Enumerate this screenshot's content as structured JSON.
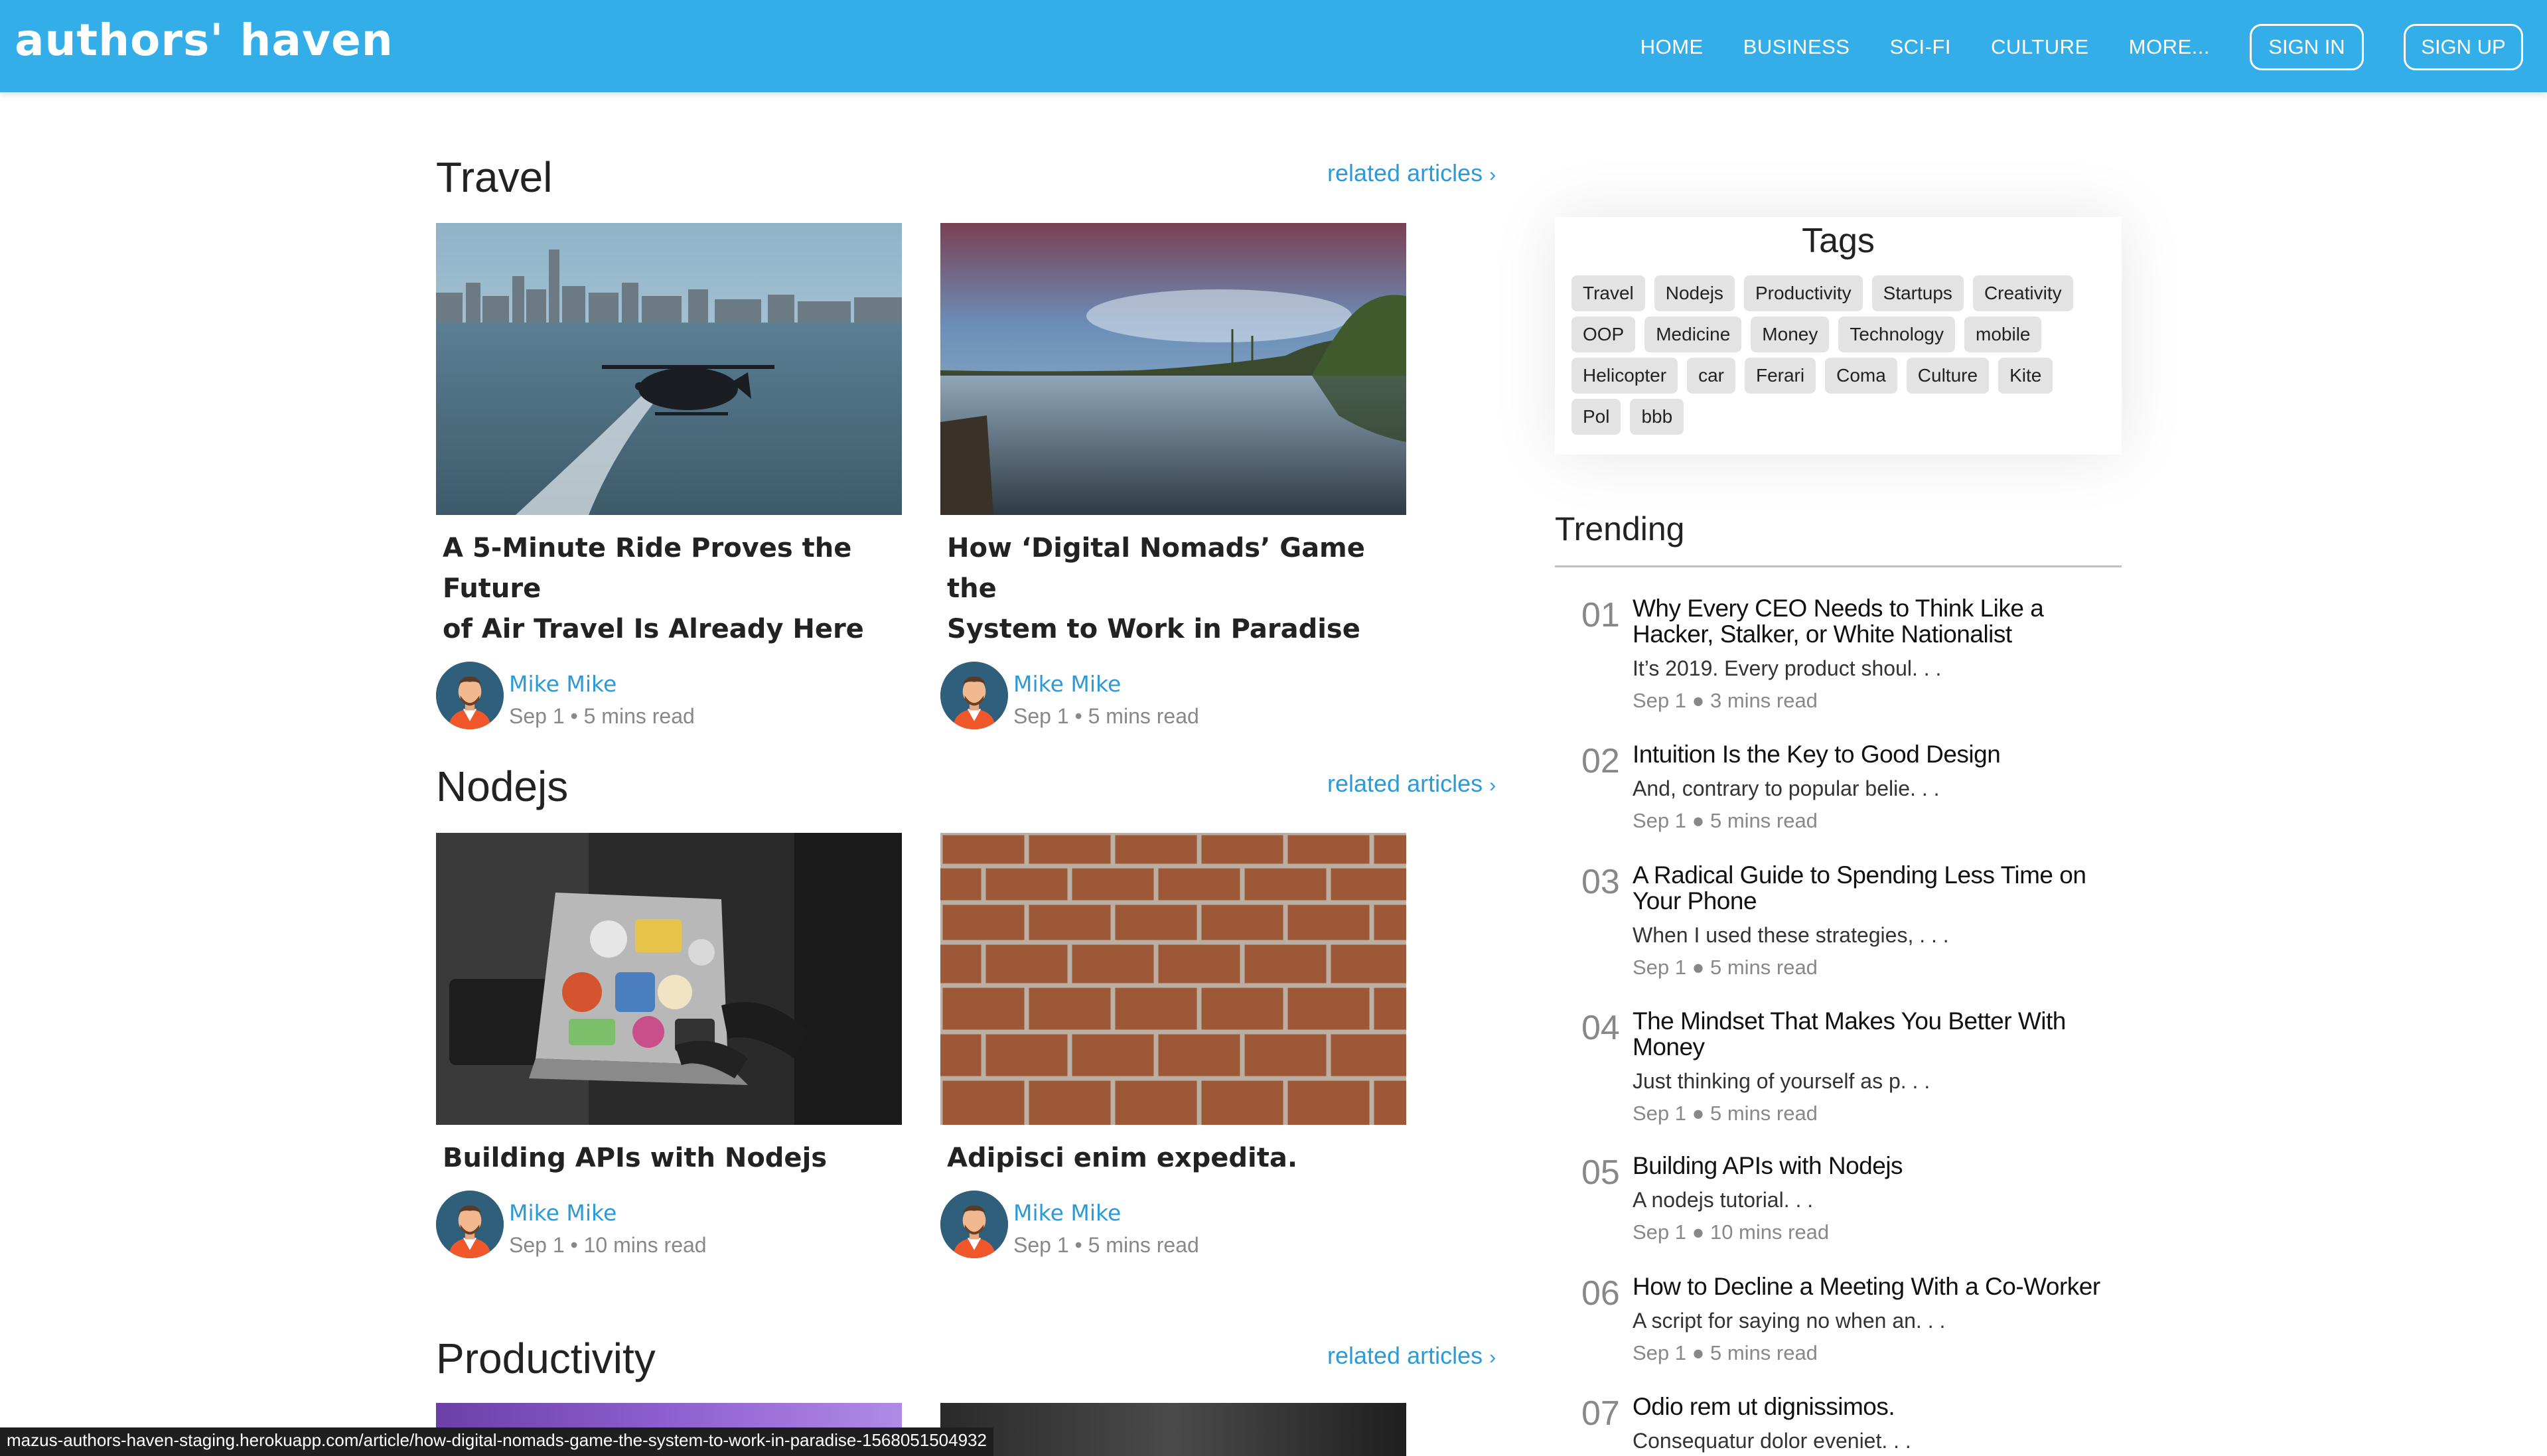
{
  "header": {
    "logo": "authors' haven",
    "nav": [
      "HOME",
      "BUSINESS",
      "SCI-FI",
      "CULTURE",
      "MORE..."
    ],
    "signin": "SIGN IN",
    "signup": "SIGN UP"
  },
  "related_label": "related articles",
  "sections": [
    {
      "title": "Travel",
      "cards": [
        {
          "title_l1": "A 5-Minute Ride Proves the Future",
          "title_l2": "of Air Travel Is Already Here",
          "author": "Mike Mike",
          "meta": "Sep 1 • 5 mins read"
        },
        {
          "title_l1": "How ‘Digital Nomads’ Game the",
          "title_l2": "System to Work in Paradise",
          "author": "Mike Mike",
          "meta": "Sep 1 • 5 mins read"
        }
      ]
    },
    {
      "title": "Nodejs",
      "cards": [
        {
          "title_l1": "Building APIs with Nodejs",
          "author": "Mike Mike",
          "meta": "Sep 1 • 10 mins read"
        },
        {
          "title_l1": "Adipisci enim expedita.",
          "author": "Mike Mike",
          "meta": "Sep 1 • 5 mins read"
        }
      ]
    },
    {
      "title": "Productivity"
    }
  ],
  "tags_panel": {
    "title": "Tags",
    "tags": [
      "Travel",
      "Nodejs",
      "Productivity",
      "Startups",
      "Creativity",
      "OOP",
      "Medicine",
      "Money",
      "Technology",
      "mobile",
      "Helicopter",
      "car",
      "Ferari",
      "Coma",
      "Culture",
      "Kite",
      "Pol",
      "bbb"
    ]
  },
  "trending": {
    "title": "Trending",
    "items": [
      {
        "num": "01",
        "title_l1": "Why Every CEO Needs to Think Like a",
        "title_l2": "Hacker, Stalker, or White Nationalist",
        "summary": "It’s 2019. Every product shoul. . .",
        "meta": "Sep 1 ● 3 mins read"
      },
      {
        "num": "02",
        "title_l1": "Intuition Is the Key to Good Design",
        "summary": "And, contrary to popular belie. . .",
        "meta": "Sep 1 ● 5 mins read"
      },
      {
        "num": "03",
        "title_l1": "A Radical Guide to Spending Less Time on",
        "title_l2": "Your Phone",
        "summary": "When I used these strategies, . . .",
        "meta": "Sep 1 ● 5 mins read"
      },
      {
        "num": "04",
        "title_l1": "The Mindset That Makes You Better With",
        "title_l2": "Money",
        "summary": "Just thinking of yourself as p. . .",
        "meta": "Sep 1 ● 5 mins read"
      },
      {
        "num": "05",
        "title_l1": "Building APIs with Nodejs",
        "summary": "A nodejs tutorial. . .",
        "meta": "Sep 1 ● 10 mins read"
      },
      {
        "num": "06",
        "title_l1": "How to Decline a Meeting With a Co-Worker",
        "summary": "A script for saying no when an. . .",
        "meta": "Sep 1 ● 5 mins read"
      },
      {
        "num": "07",
        "title_l1": "Odio rem ut dignissimos.",
        "summary": "Consequatur dolor eveniet. . ."
      }
    ]
  },
  "status_url": "mazus-authors-haven-staging.herokuapp.com/article/how-digital-nomads-game-the-system-to-work-in-paradise-1568051504932",
  "colors": {
    "brand": "#34aee8",
    "link": "#2d9ad8"
  }
}
